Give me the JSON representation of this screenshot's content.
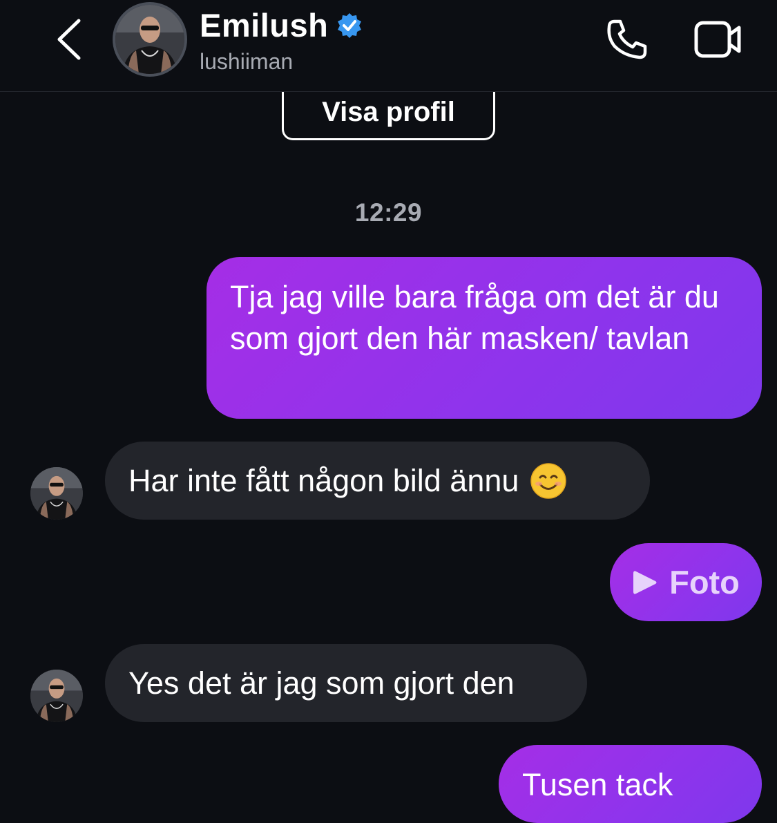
{
  "header": {
    "contact_name": "Emilush",
    "username": "lushiiman",
    "verified": true,
    "icons": {
      "back": "chevron-left-icon",
      "call": "phone-icon",
      "video": "video-camera-icon",
      "verified": "verified-badge-icon"
    }
  },
  "profile_button": {
    "label": "Visa profil"
  },
  "thread": {
    "timestamp": "12:29",
    "messages": [
      {
        "direction": "outgoing",
        "type": "text",
        "text": "Tja jag ville bara fråga om det är du som gjort den här masken/ tavlan"
      },
      {
        "direction": "incoming",
        "type": "text",
        "text": "Har inte fått någon bild ännu",
        "emoji": "smiling-face-icon"
      },
      {
        "direction": "outgoing",
        "type": "media",
        "text": "Foto",
        "icon": "play-icon"
      },
      {
        "direction": "incoming",
        "type": "text",
        "text": "Yes det är jag som gjort den"
      },
      {
        "direction": "outgoing",
        "type": "text",
        "text": "Tusen tack",
        "partially_visible": true
      }
    ]
  },
  "colors": {
    "background": "#0c0e13",
    "incoming_bubble": "#23252b",
    "outgoing_gradient_start": "#a52ee6",
    "outgoing_gradient_end": "#7e38ec",
    "verified_blue": "#3897f0",
    "secondary_text": "#a8abb3"
  }
}
